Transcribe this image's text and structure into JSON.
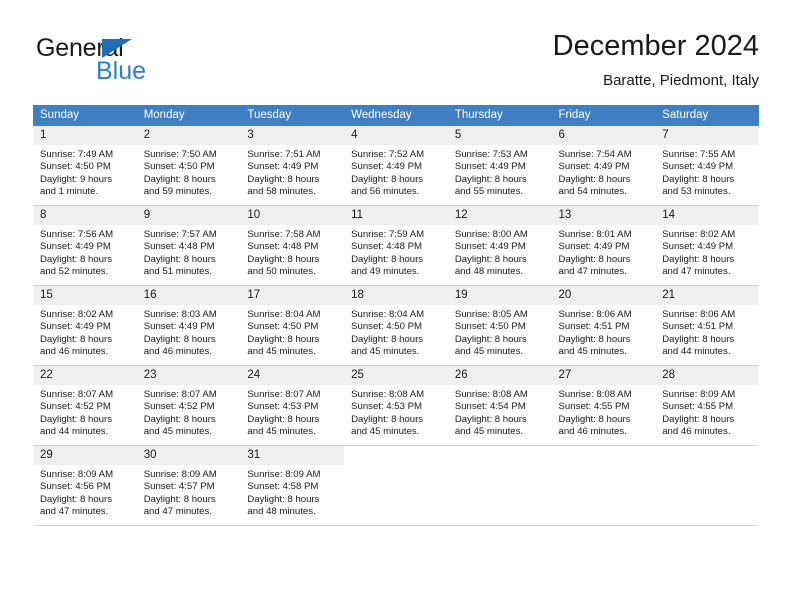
{
  "brand": {
    "name_part1": "General",
    "name_part2": "Blue",
    "triangle_color": "#1f6fb5",
    "blue_color": "#2a7fd4"
  },
  "header": {
    "title": "December 2024",
    "subtitle": "Baratte, Piedmont, Italy"
  },
  "theme": {
    "header_bg": "#3f7fc1",
    "daynum_bg": "#efefef",
    "grid_line": "#cfcfcf"
  },
  "weekday_headers": [
    "Sunday",
    "Monday",
    "Tuesday",
    "Wednesday",
    "Thursday",
    "Friday",
    "Saturday"
  ],
  "weeks": [
    [
      {
        "day": "1",
        "sunrise": "Sunrise: 7:49 AM",
        "sunset": "Sunset: 4:50 PM",
        "daylight1": "Daylight: 9 hours",
        "daylight2": "and 1 minute."
      },
      {
        "day": "2",
        "sunrise": "Sunrise: 7:50 AM",
        "sunset": "Sunset: 4:50 PM",
        "daylight1": "Daylight: 8 hours",
        "daylight2": "and 59 minutes."
      },
      {
        "day": "3",
        "sunrise": "Sunrise: 7:51 AM",
        "sunset": "Sunset: 4:49 PM",
        "daylight1": "Daylight: 8 hours",
        "daylight2": "and 58 minutes."
      },
      {
        "day": "4",
        "sunrise": "Sunrise: 7:52 AM",
        "sunset": "Sunset: 4:49 PM",
        "daylight1": "Daylight: 8 hours",
        "daylight2": "and 56 minutes."
      },
      {
        "day": "5",
        "sunrise": "Sunrise: 7:53 AM",
        "sunset": "Sunset: 4:49 PM",
        "daylight1": "Daylight: 8 hours",
        "daylight2": "and 55 minutes."
      },
      {
        "day": "6",
        "sunrise": "Sunrise: 7:54 AM",
        "sunset": "Sunset: 4:49 PM",
        "daylight1": "Daylight: 8 hours",
        "daylight2": "and 54 minutes."
      },
      {
        "day": "7",
        "sunrise": "Sunrise: 7:55 AM",
        "sunset": "Sunset: 4:49 PM",
        "daylight1": "Daylight: 8 hours",
        "daylight2": "and 53 minutes."
      }
    ],
    [
      {
        "day": "8",
        "sunrise": "Sunrise: 7:56 AM",
        "sunset": "Sunset: 4:49 PM",
        "daylight1": "Daylight: 8 hours",
        "daylight2": "and 52 minutes."
      },
      {
        "day": "9",
        "sunrise": "Sunrise: 7:57 AM",
        "sunset": "Sunset: 4:48 PM",
        "daylight1": "Daylight: 8 hours",
        "daylight2": "and 51 minutes."
      },
      {
        "day": "10",
        "sunrise": "Sunrise: 7:58 AM",
        "sunset": "Sunset: 4:48 PM",
        "daylight1": "Daylight: 8 hours",
        "daylight2": "and 50 minutes."
      },
      {
        "day": "11",
        "sunrise": "Sunrise: 7:59 AM",
        "sunset": "Sunset: 4:48 PM",
        "daylight1": "Daylight: 8 hours",
        "daylight2": "and 49 minutes."
      },
      {
        "day": "12",
        "sunrise": "Sunrise: 8:00 AM",
        "sunset": "Sunset: 4:49 PM",
        "daylight1": "Daylight: 8 hours",
        "daylight2": "and 48 minutes."
      },
      {
        "day": "13",
        "sunrise": "Sunrise: 8:01 AM",
        "sunset": "Sunset: 4:49 PM",
        "daylight1": "Daylight: 8 hours",
        "daylight2": "and 47 minutes."
      },
      {
        "day": "14",
        "sunrise": "Sunrise: 8:02 AM",
        "sunset": "Sunset: 4:49 PM",
        "daylight1": "Daylight: 8 hours",
        "daylight2": "and 47 minutes."
      }
    ],
    [
      {
        "day": "15",
        "sunrise": "Sunrise: 8:02 AM",
        "sunset": "Sunset: 4:49 PM",
        "daylight1": "Daylight: 8 hours",
        "daylight2": "and 46 minutes."
      },
      {
        "day": "16",
        "sunrise": "Sunrise: 8:03 AM",
        "sunset": "Sunset: 4:49 PM",
        "daylight1": "Daylight: 8 hours",
        "daylight2": "and 46 minutes."
      },
      {
        "day": "17",
        "sunrise": "Sunrise: 8:04 AM",
        "sunset": "Sunset: 4:50 PM",
        "daylight1": "Daylight: 8 hours",
        "daylight2": "and 45 minutes."
      },
      {
        "day": "18",
        "sunrise": "Sunrise: 8:04 AM",
        "sunset": "Sunset: 4:50 PM",
        "daylight1": "Daylight: 8 hours",
        "daylight2": "and 45 minutes."
      },
      {
        "day": "19",
        "sunrise": "Sunrise: 8:05 AM",
        "sunset": "Sunset: 4:50 PM",
        "daylight1": "Daylight: 8 hours",
        "daylight2": "and 45 minutes."
      },
      {
        "day": "20",
        "sunrise": "Sunrise: 8:06 AM",
        "sunset": "Sunset: 4:51 PM",
        "daylight1": "Daylight: 8 hours",
        "daylight2": "and 45 minutes."
      },
      {
        "day": "21",
        "sunrise": "Sunrise: 8:06 AM",
        "sunset": "Sunset: 4:51 PM",
        "daylight1": "Daylight: 8 hours",
        "daylight2": "and 44 minutes."
      }
    ],
    [
      {
        "day": "22",
        "sunrise": "Sunrise: 8:07 AM",
        "sunset": "Sunset: 4:52 PM",
        "daylight1": "Daylight: 8 hours",
        "daylight2": "and 44 minutes."
      },
      {
        "day": "23",
        "sunrise": "Sunrise: 8:07 AM",
        "sunset": "Sunset: 4:52 PM",
        "daylight1": "Daylight: 8 hours",
        "daylight2": "and 45 minutes."
      },
      {
        "day": "24",
        "sunrise": "Sunrise: 8:07 AM",
        "sunset": "Sunset: 4:53 PM",
        "daylight1": "Daylight: 8 hours",
        "daylight2": "and 45 minutes."
      },
      {
        "day": "25",
        "sunrise": "Sunrise: 8:08 AM",
        "sunset": "Sunset: 4:53 PM",
        "daylight1": "Daylight: 8 hours",
        "daylight2": "and 45 minutes."
      },
      {
        "day": "26",
        "sunrise": "Sunrise: 8:08 AM",
        "sunset": "Sunset: 4:54 PM",
        "daylight1": "Daylight: 8 hours",
        "daylight2": "and 45 minutes."
      },
      {
        "day": "27",
        "sunrise": "Sunrise: 8:08 AM",
        "sunset": "Sunset: 4:55 PM",
        "daylight1": "Daylight: 8 hours",
        "daylight2": "and 46 minutes."
      },
      {
        "day": "28",
        "sunrise": "Sunrise: 8:09 AM",
        "sunset": "Sunset: 4:55 PM",
        "daylight1": "Daylight: 8 hours",
        "daylight2": "and 46 minutes."
      }
    ],
    [
      {
        "day": "29",
        "sunrise": "Sunrise: 8:09 AM",
        "sunset": "Sunset: 4:56 PM",
        "daylight1": "Daylight: 8 hours",
        "daylight2": "and 47 minutes."
      },
      {
        "day": "30",
        "sunrise": "Sunrise: 8:09 AM",
        "sunset": "Sunset: 4:57 PM",
        "daylight1": "Daylight: 8 hours",
        "daylight2": "and 47 minutes."
      },
      {
        "day": "31",
        "sunrise": "Sunrise: 8:09 AM",
        "sunset": "Sunset: 4:58 PM",
        "daylight1": "Daylight: 8 hours",
        "daylight2": "and 48 minutes."
      },
      {
        "day": "",
        "sunrise": "",
        "sunset": "",
        "daylight1": "",
        "daylight2": ""
      },
      {
        "day": "",
        "sunrise": "",
        "sunset": "",
        "daylight1": "",
        "daylight2": ""
      },
      {
        "day": "",
        "sunrise": "",
        "sunset": "",
        "daylight1": "",
        "daylight2": ""
      },
      {
        "day": "",
        "sunrise": "",
        "sunset": "",
        "daylight1": "",
        "daylight2": ""
      }
    ]
  ]
}
